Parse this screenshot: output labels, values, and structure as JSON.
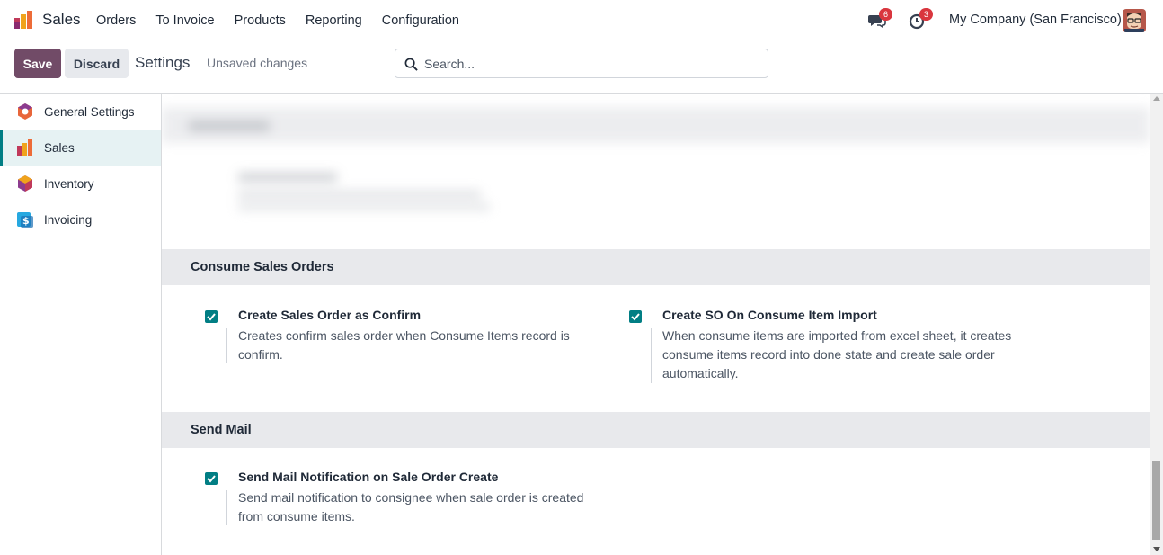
{
  "app": {
    "name": "Sales",
    "menu": [
      "Orders",
      "To Invoice",
      "Products",
      "Reporting",
      "Configuration"
    ]
  },
  "systray": {
    "messages_count": "6",
    "activities_count": "3",
    "company": "My Company (San Francisco)"
  },
  "control_panel": {
    "save_label": "Save",
    "discard_label": "Discard",
    "title": "Settings",
    "status": "Unsaved changes",
    "search_placeholder": "Search..."
  },
  "sidebar": {
    "items": [
      {
        "label": "General Settings",
        "icon": "general-settings-icon",
        "active": false
      },
      {
        "label": "Sales",
        "icon": "sales-app-icon",
        "active": true
      },
      {
        "label": "Inventory",
        "icon": "inventory-app-icon",
        "active": false
      },
      {
        "label": "Invoicing",
        "icon": "invoicing-app-icon",
        "active": false
      }
    ]
  },
  "sections": [
    {
      "title": "Consume Sales Orders",
      "settings": [
        {
          "title": "Create Sales Order as Confirm",
          "description": "Creates confirm sales order when Consume Items record is confirm.",
          "checked": true
        },
        {
          "title": "Create SO On Consume Item Import",
          "description": "When consume items are imported from excel sheet, it creates consume items record into done state and create sale order automatically.",
          "checked": true
        }
      ]
    },
    {
      "title": "Send Mail",
      "settings": [
        {
          "title": "Send Mail Notification on Sale Order Create",
          "description": "Send mail notification to consignee when sale order is created from consume items.",
          "checked": true
        }
      ]
    }
  ],
  "colors": {
    "primary": "#714b67",
    "accent": "#017e84",
    "badge": "#d9363e"
  }
}
